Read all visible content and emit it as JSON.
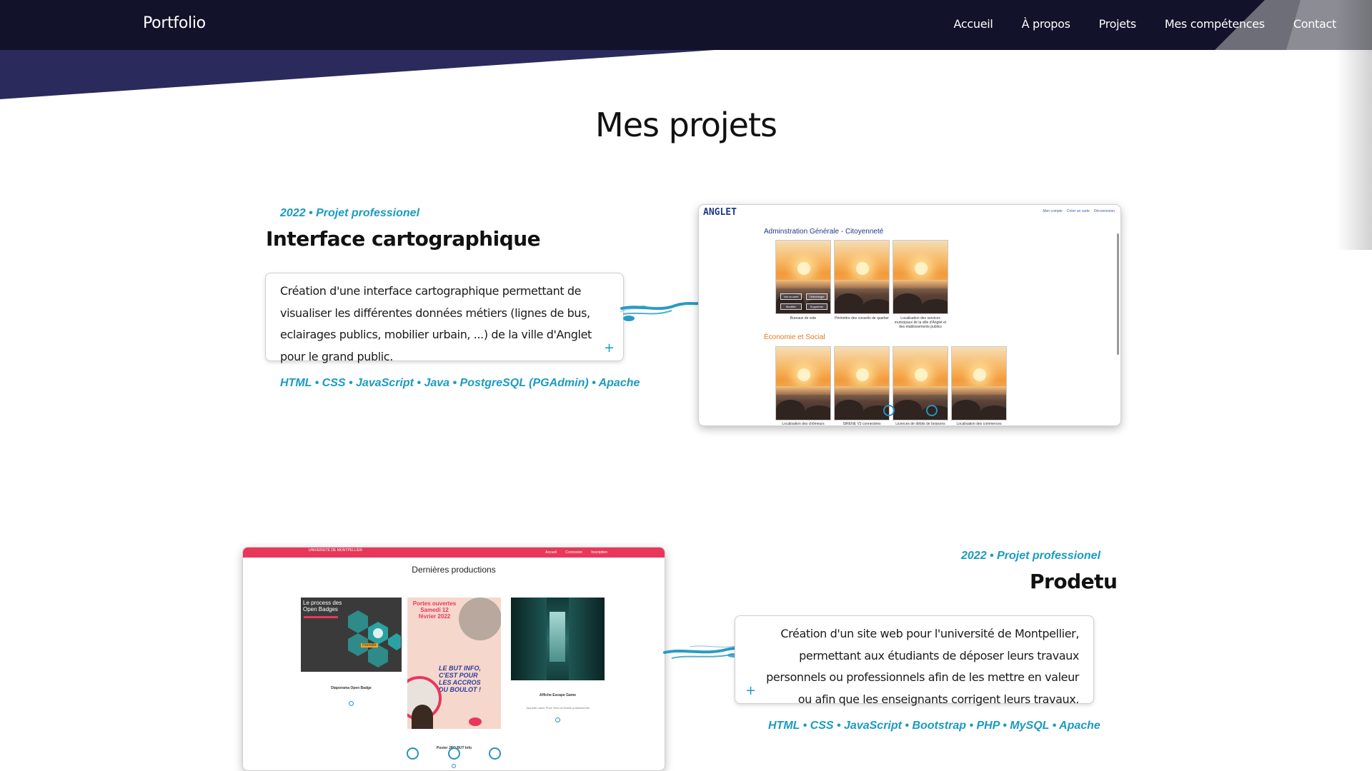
{
  "header": {
    "brand": "Portfolio",
    "nav": [
      "Accueil",
      "À propos",
      "Projets",
      "Mes compétences",
      "Contact"
    ]
  },
  "page_title": "Mes projets",
  "projects": [
    {
      "meta": "2022 • Projet professionel",
      "title": "Interface cartographique",
      "description_lines": [
        "Création d'une interface cartographique permettant de",
        "visualiser les différentes données métiers (lignes de bus,",
        "eclairages publics, mobilier urbain, ...) de la ville d'Anglet",
        "pour le grand public."
      ],
      "expand_symbol": "+",
      "tech": "HTML • CSS • JavaScript • Java • PostgreSQL (PGAdmin) • Apache",
      "screenshot": {
        "logo": "ANGLET",
        "nav": [
          "Mon compte",
          "Créer un carte",
          "Déconnexion"
        ],
        "category_1": "Adminstration Générale - Citoyenneté",
        "category_2": "Économie et Social",
        "tile_buttons": [
          "Voir la carte",
          "Télécharger",
          "Modifier",
          "Supprimer"
        ],
        "tiles_row_1": [
          "Bureaux de vote",
          "Périmètre des conseils de quartier",
          "Localisation des services municipaux de la ville d'Anglet et des établissements publics"
        ],
        "tiles_row_2": [
          "Localisation des chômeurs",
          "SIRENE V3 connectées",
          "Licences de débits de boissons",
          "Localisation des commerces"
        ]
      }
    },
    {
      "meta": "2022 • Projet professionel",
      "title": "Prodetu",
      "description_lines": [
        "Création d'un site web pour l'université de Montpellier,",
        "permettant aux étudiants de déposer leurs travaux",
        "personnels ou professionnels afin de les mettre en valeur",
        "ou afin que les enseignants corrigent leurs travaux."
      ],
      "expand_symbol": "+",
      "tech": "HTML • CSS • JavaScript • Bootstrap • PHP • MySQL • Apache",
      "screenshot": {
        "logo": "UNIVERSITÉ DE MONTPELLIER",
        "nav": [
          "Accueil",
          "Connexion",
          "Inscription"
        ],
        "title": "Dernières productions",
        "card_1": {
          "heading": "Le process des Open Badges",
          "label": "Diaporama Open Badge",
          "badge": "moodle"
        },
        "card_2": {
          "heading": "Portes ouvertes Samedi 12 février 2022",
          "slogan": "LE BUT INFO, C'EST POUR LES ACCROS DU BOULOT !",
          "label": "Poster JPO BUT Info"
        },
        "card_3": {
          "label": "Affiche Escape Game",
          "sub": "Jaquette name Prod. Rom et Mobile professionnel"
        }
      }
    }
  ],
  "colors": {
    "header_dark": "#12122a",
    "header_band": "#2a2a5c",
    "accent": "#1a9bc2",
    "prodetu_red": "#e8375a",
    "anglet_blue": "#1e3a8a",
    "anglet_orange": "#e37b1f"
  }
}
